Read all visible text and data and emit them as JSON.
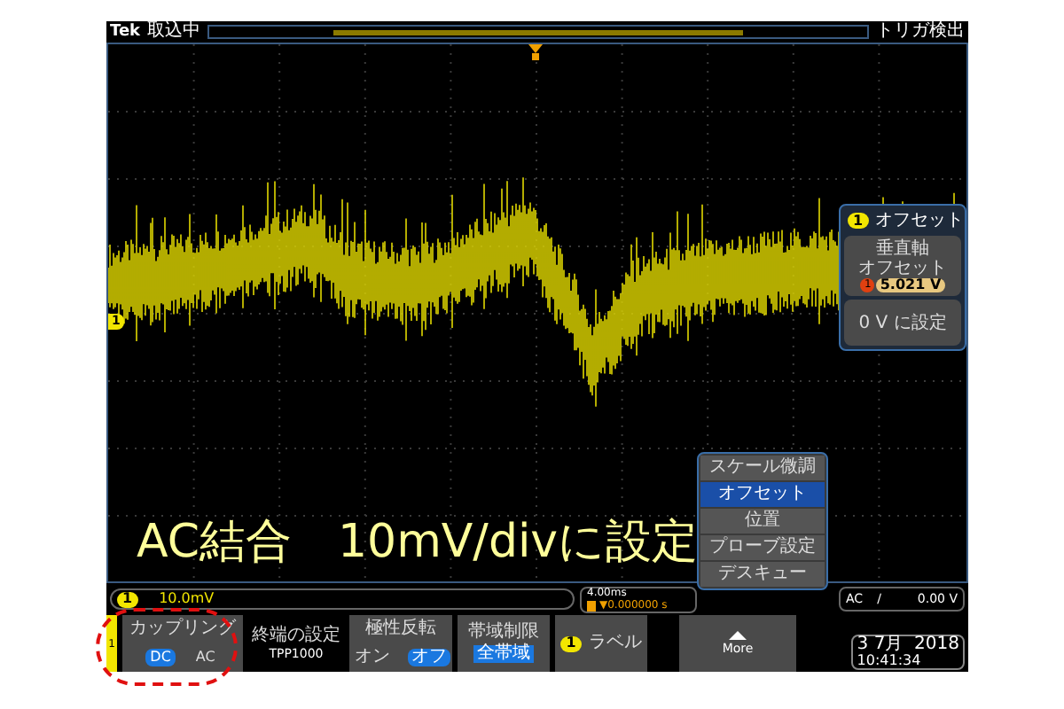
{
  "top_bar": {
    "brand": "Tek",
    "status": "取込中",
    "trigger_status": "トリガ検出"
  },
  "channel_marker": "1",
  "offset_panel": {
    "badge": "1",
    "title": "オフセット",
    "label_lines": [
      "垂直軸",
      "オフセット"
    ],
    "value_badge": "1",
    "value": "5.021 V",
    "set_zero": "0 V に設定"
  },
  "menu": [
    {
      "label": "スケール微調",
      "selected": false
    },
    {
      "label": "オフセット",
      "selected": true
    },
    {
      "label": "位置",
      "selected": false
    },
    {
      "label": "プローブ設定",
      "selected": false
    },
    {
      "label": "デスキュー",
      "selected": false
    }
  ],
  "caption": "AC結合　10mV/divに設定",
  "status": {
    "channel_badge": "1",
    "scale": "10.0mV",
    "time_scale": "4.00ms",
    "time_position": "▼0.000000 s",
    "trigger_coupling": "AC",
    "trigger_slope": "/",
    "trigger_level": "0.00 V"
  },
  "bottom": {
    "channel_tab": "1",
    "coupling": {
      "label": "カップリング",
      "options": [
        {
          "label": "DC",
          "selected": true
        },
        {
          "label": "AC",
          "selected": false
        }
      ]
    },
    "termination": {
      "label": "終端の設定",
      "value": "TPP1000"
    },
    "invert": {
      "label": "極性反転",
      "options": [
        {
          "label": "オン",
          "selected": false
        },
        {
          "label": "オフ",
          "selected": true
        }
      ]
    },
    "bandwidth": {
      "label": "帯域制限",
      "value": "全帯域"
    },
    "label_button": {
      "badge": "1",
      "label": "ラベル"
    },
    "more": "More",
    "date": "3 7月  2018",
    "time": "10:41:34"
  }
}
